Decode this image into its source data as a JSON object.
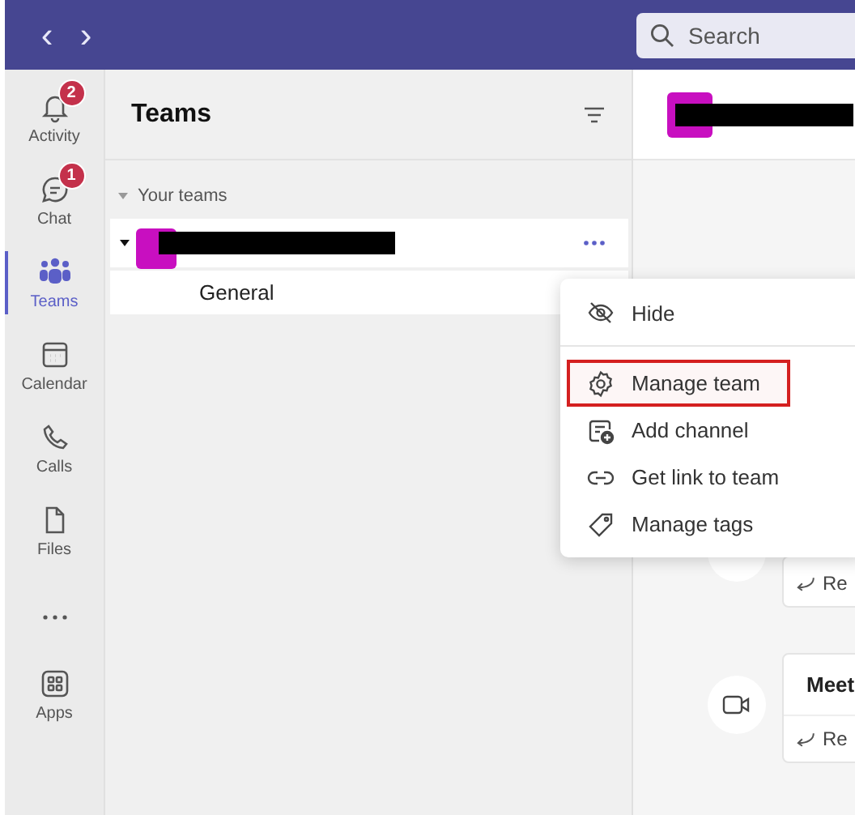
{
  "top_bar": {
    "back": "‹",
    "forward": "›",
    "search": {
      "placeholder": "Search"
    }
  },
  "rail": [
    {
      "label": "Activity",
      "badge": "2",
      "selected": false
    },
    {
      "label": "Chat",
      "badge": "1",
      "selected": false
    },
    {
      "label": "Teams",
      "selected": true
    },
    {
      "label": "Calendar",
      "selected": false
    },
    {
      "label": "Calls",
      "selected": false
    },
    {
      "label": "Files",
      "selected": false
    },
    {
      "kind": "more",
      "selected": false
    },
    {
      "label": "Apps",
      "selected": false
    }
  ],
  "teams_panel": {
    "title": "Teams",
    "section": "Your teams",
    "expanded": true,
    "teams": [
      {
        "expanded": true,
        "channels": [
          {
            "name": "General",
            "selected": false
          }
        ]
      }
    ]
  },
  "context_menu": [
    {
      "label": "Hide",
      "separator_after": true,
      "highlighted": false
    },
    {
      "label": "Manage team",
      "separator_after": false,
      "highlighted": true
    },
    {
      "label": "Add channel",
      "separator_after": false,
      "highlighted": false
    },
    {
      "label": "Get link to team",
      "separator_after": false,
      "highlighted": false
    },
    {
      "label": "Manage tags",
      "separator_after": false,
      "highlighted": false
    }
  ],
  "feed": [
    {
      "kind": "reply",
      "reply": "Re"
    },
    {
      "kind": "meeting",
      "title": "Meet",
      "reply": "Re"
    }
  ]
}
